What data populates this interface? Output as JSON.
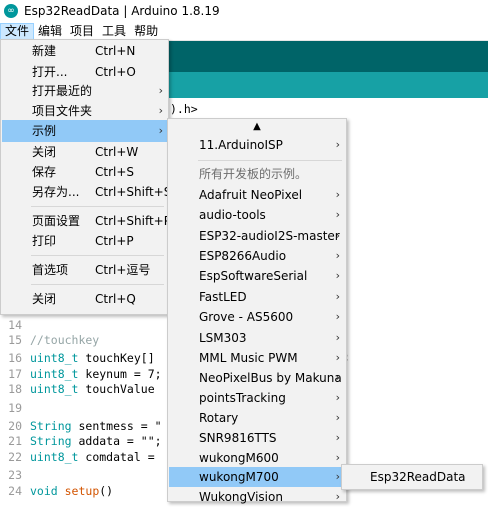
{
  "window": {
    "title": "Esp32ReadData | Arduino 1.8.19"
  },
  "menubar": [
    "文件",
    "编辑",
    "项目",
    "工具",
    "帮助"
  ],
  "file_menu": [
    {
      "label": "新建",
      "shortcut": "Ctrl+N",
      "arrow": ""
    },
    {
      "label": "打开...",
      "shortcut": "Ctrl+O",
      "arrow": ""
    },
    {
      "label": "打开最近的",
      "shortcut": "",
      "arrow": "›"
    },
    {
      "label": "项目文件夹",
      "shortcut": "",
      "arrow": "›"
    },
    {
      "label": "示例",
      "shortcut": "",
      "arrow": "›"
    },
    {
      "label": "关闭",
      "shortcut": "Ctrl+W",
      "arrow": ""
    },
    {
      "label": "保存",
      "shortcut": "Ctrl+S",
      "arrow": ""
    },
    {
      "label": "另存为...",
      "shortcut": "Ctrl+Shift+S",
      "arrow": ""
    },
    {
      "label": "页面设置",
      "shortcut": "Ctrl+Shift+P",
      "arrow": ""
    },
    {
      "label": "打印",
      "shortcut": "Ctrl+P",
      "arrow": ""
    },
    {
      "label": "首选项",
      "shortcut": "Ctrl+逗号",
      "arrow": ""
    },
    {
      "label": "关闭",
      "shortcut": "Ctrl+Q",
      "arrow": ""
    }
  ],
  "examples_menu": {
    "scroll_up": "▲",
    "items": [
      {
        "label": "11.ArduinoISP",
        "arrow": "›"
      },
      {
        "label": "所有开发板的示例。",
        "arrow": ""
      },
      {
        "label": "Adafruit NeoPixel",
        "arrow": "›"
      },
      {
        "label": "audio-tools",
        "arrow": "›"
      },
      {
        "label": "ESP32-audioI2S-master",
        "arrow": "›"
      },
      {
        "label": "ESP8266Audio",
        "arrow": "›"
      },
      {
        "label": "EspSoftwareSerial",
        "arrow": "›"
      },
      {
        "label": "FastLED",
        "arrow": "›"
      },
      {
        "label": "Grove - AS5600",
        "arrow": "›"
      },
      {
        "label": "LSM303",
        "arrow": "›"
      },
      {
        "label": "MML Music PWM",
        "arrow": "›"
      },
      {
        "label": "NeoPixelBus by Makuna",
        "arrow": "›"
      },
      {
        "label": "pointsTracking",
        "arrow": "›"
      },
      {
        "label": "Rotary",
        "arrow": "›"
      },
      {
        "label": "SNR9816TTS",
        "arrow": "›"
      },
      {
        "label": "wukongM600",
        "arrow": "›"
      },
      {
        "label": "wukongM700",
        "arrow": "›"
      },
      {
        "label": "WukongVision",
        "arrow": "›"
      }
    ]
  },
  "wukong_submenu": [
    "Esp32ReadData"
  ],
  "editor": {
    "fragment_top": ").h>",
    "fragment_right": ";",
    "lines": [
      {
        "n": "14",
        "a": "",
        "b": "",
        "c": ""
      },
      {
        "n": "15",
        "a": "",
        "b": "//touchkey",
        "c": ""
      },
      {
        "n": "16",
        "a": "uint8_t",
        "b": " touchKey[]",
        "c": ""
      },
      {
        "n": "17",
        "a": "uint8_t",
        "b": " keynum = 7;",
        "c": ""
      },
      {
        "n": "18",
        "a": "uint8_t",
        "b": " touchValue",
        "c": ""
      },
      {
        "n": "19",
        "a": "",
        "b": "",
        "c": ""
      },
      {
        "n": "20",
        "a": "String",
        "b": " sentmess = \"",
        "c": ""
      },
      {
        "n": "21",
        "a": "String",
        "b": " addata = \"\";",
        "c": ""
      },
      {
        "n": "22",
        "a": "uint8_t",
        "b": " comdatal =",
        "c": ""
      },
      {
        "n": "23",
        "a": "",
        "b": "",
        "c": ""
      },
      {
        "n": "24",
        "a": "void",
        "b": " setup",
        "c": "()"
      }
    ]
  },
  "colors": {
    "toolbar": "#006468",
    "tabstrip": "#17a1a5",
    "highlight": "#91c9f7"
  }
}
